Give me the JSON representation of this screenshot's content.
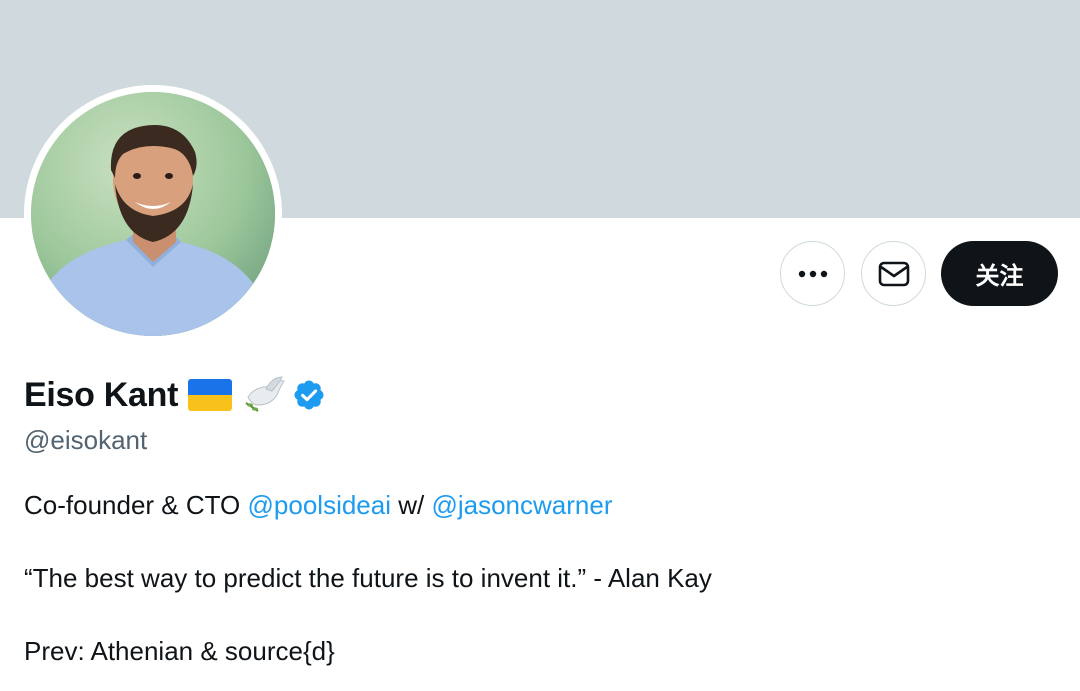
{
  "profile": {
    "display_name": "Eiso Kant",
    "handle": "@eisokant",
    "name_badges": [
      "ukraine-flag-icon",
      "dove-icon",
      "verified-icon"
    ],
    "avatar_alt": "profile photo"
  },
  "actions": {
    "more_label": "more-icon",
    "message_label": "envelope-icon",
    "follow_label": "关注"
  },
  "bio": {
    "line1": {
      "prefix": "Co-founder & CTO ",
      "mention1": "@poolsideai",
      "middle": " w/ ",
      "mention2": "@jasoncwarner"
    },
    "line2": "“The best way to predict the future is to invent it.” - Alan Kay",
    "line3": "Prev: Athenian & source{d}"
  },
  "colors": {
    "banner": "#cfd9de",
    "link": "#1d9bf0",
    "verified": "#1d9bf0",
    "follow_bg": "#0f1419",
    "secondary_text": "#536471"
  }
}
